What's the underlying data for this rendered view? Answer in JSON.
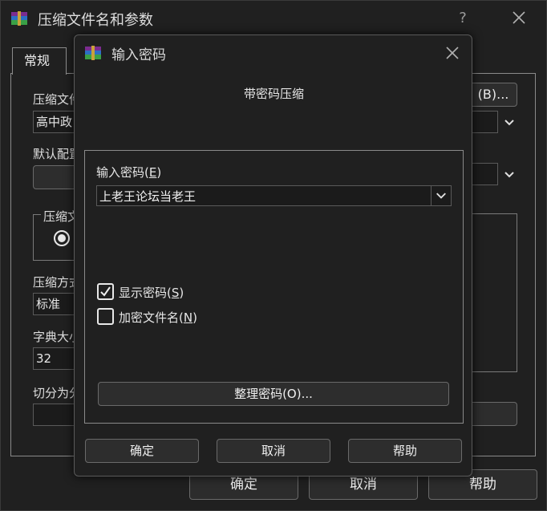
{
  "background_window": {
    "title": "压缩文件名和参数",
    "help_glyph": "?",
    "tab_general": "常规",
    "archive_name_label": "压缩文件",
    "archive_name_value": "高中政",
    "browse_button_fragment": "(B)...",
    "default_profile_label": "默认配置",
    "archive_format_group": "压缩文",
    "compression_method_label": "压缩方式",
    "compression_method_value": "标准",
    "dictionary_size_label": "字典大小",
    "dictionary_size_value": "32",
    "split_label": "切分为分",
    "ok_button": "确定",
    "cancel_button": "取消",
    "help_button": "帮助"
  },
  "dialog": {
    "title": "输入密码",
    "heading": "带密码压缩",
    "password_label": "输入密码(",
    "password_label_key": "E",
    "password_label_end": ")",
    "password_value": "上老王论坛当老王",
    "show_password": {
      "label": "显示密码(",
      "key": "S",
      "end": ")",
      "checked": true
    },
    "encrypt_names": {
      "label": "加密文件名(",
      "key": "N",
      "end": ")",
      "checked": false
    },
    "organize_button": "整理密码(O)...",
    "ok_button": "确定",
    "cancel_button": "取消",
    "help_button": "帮助"
  },
  "colors": {
    "window_bg": "#202020",
    "border": "#8a8a8a",
    "text": "#e6e6e6"
  }
}
